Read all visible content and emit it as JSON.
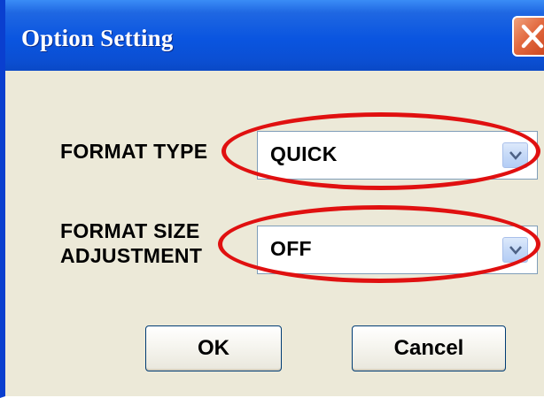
{
  "window": {
    "title": "Option Setting",
    "close_icon": "close-icon"
  },
  "form": {
    "format_type": {
      "label": "FORMAT TYPE",
      "value": "QUICK"
    },
    "format_size_adjustment": {
      "label_line1": "FORMAT SIZE",
      "label_line2": "ADJUSTMENT",
      "value": "OFF"
    }
  },
  "buttons": {
    "ok": "OK",
    "cancel": "Cancel"
  },
  "colors": {
    "titlebar": "#0a55e0",
    "dialog_bg": "#ece9d8",
    "highlight_ring": "#e01010",
    "close_button": "#e2693f"
  }
}
